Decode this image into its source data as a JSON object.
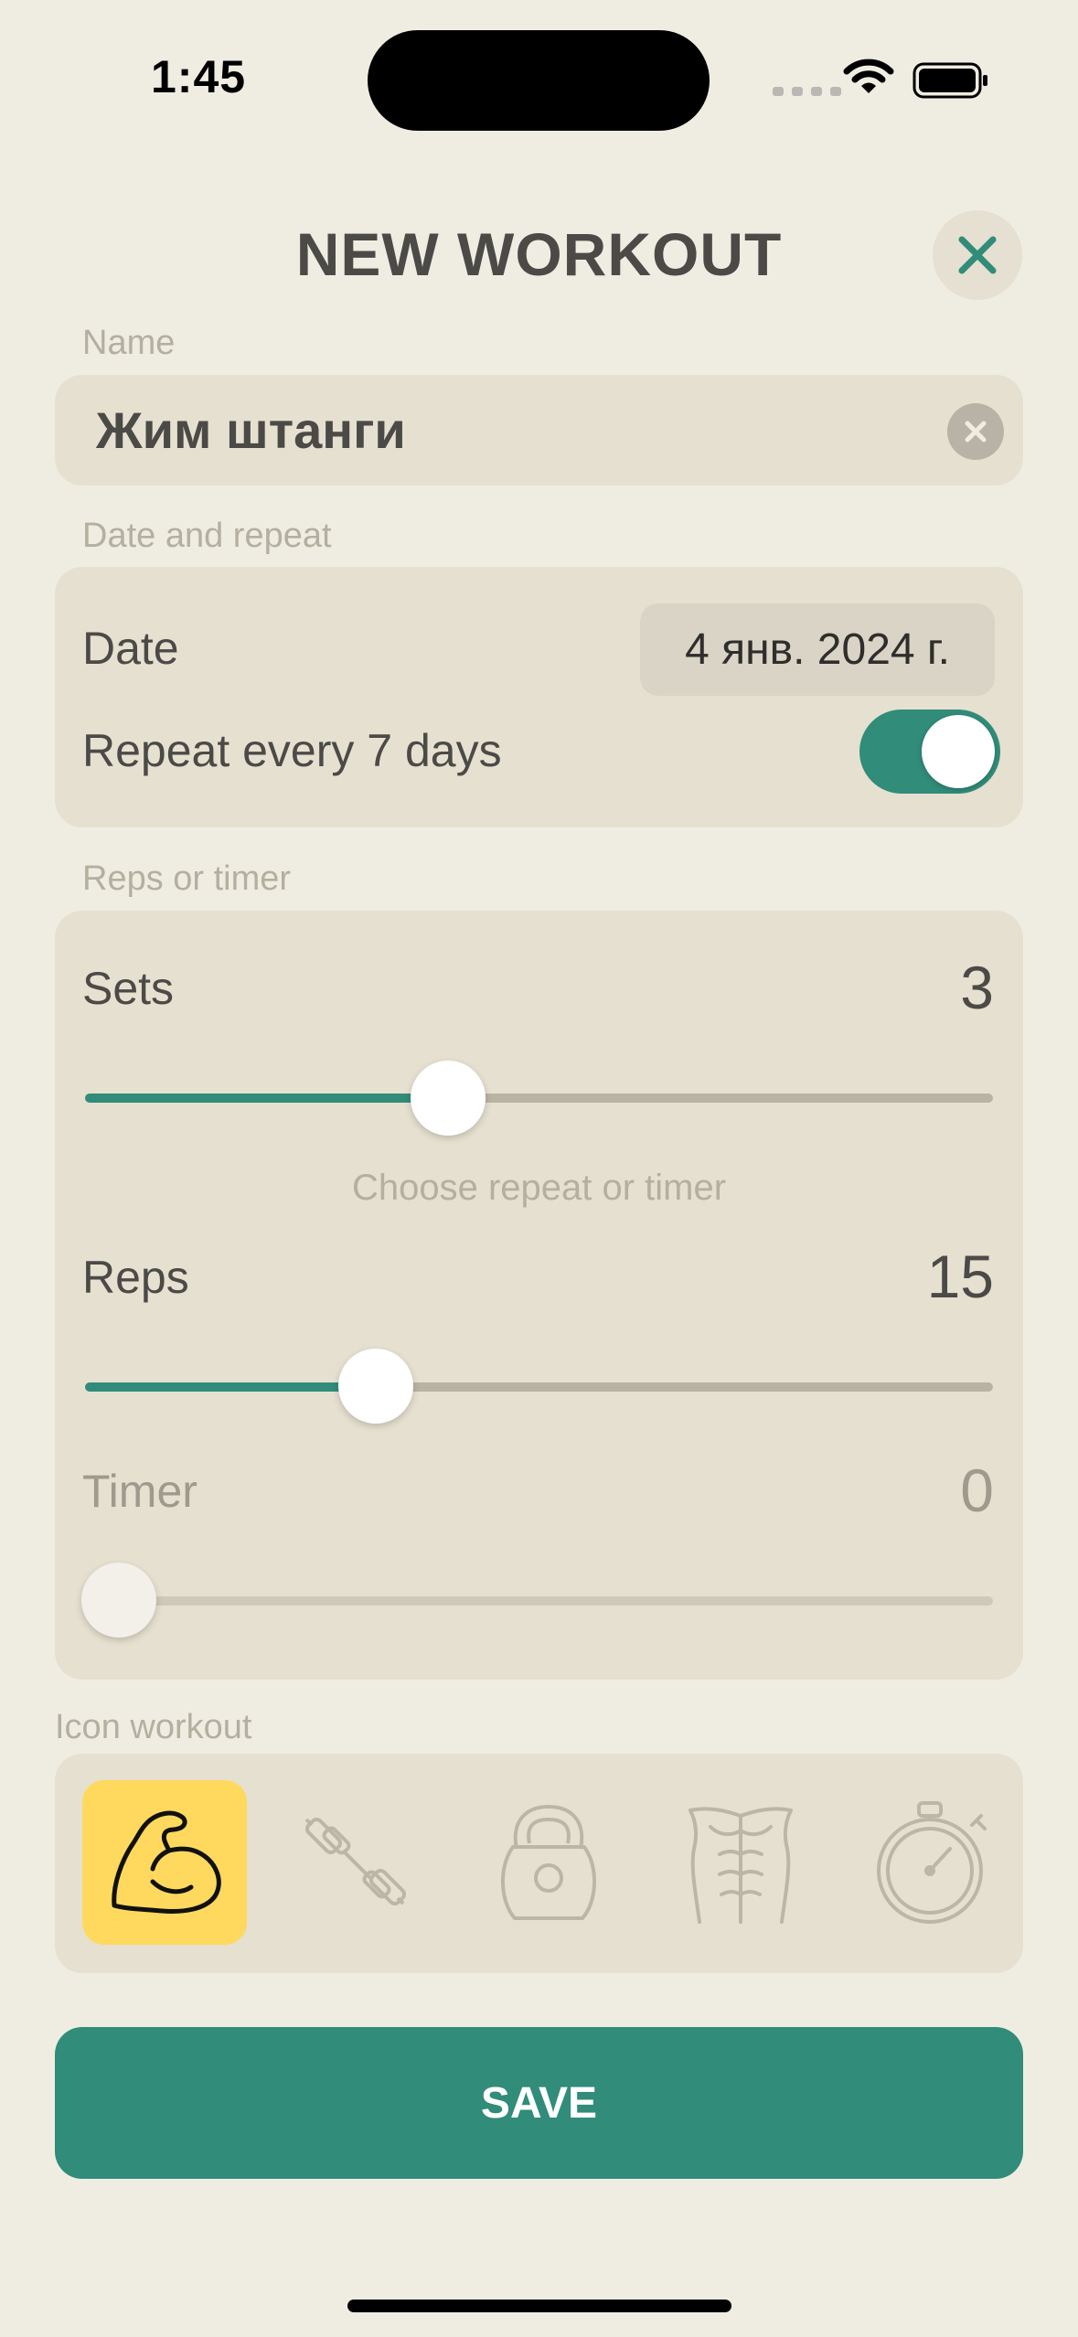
{
  "status_bar": {
    "time": "1:45"
  },
  "header": {
    "title": "NEW WORKOUT"
  },
  "name_section": {
    "label": "Name",
    "value": "Жим штанги"
  },
  "date_section": {
    "label": "Date and repeat",
    "date_label": "Date",
    "date_value": "4 янв. 2024 г.",
    "repeat_label": "Repeat every 7 days",
    "repeat_enabled": true
  },
  "reps_section": {
    "label": "Reps or timer",
    "sets": {
      "label": "Sets",
      "value": "3",
      "fraction": 0.4
    },
    "hint": "Choose repeat or timer",
    "reps": {
      "label": "Reps",
      "value": "15",
      "fraction": 0.32
    },
    "timer": {
      "label": "Timer",
      "value": "0",
      "fraction": 0.0
    }
  },
  "icon_section": {
    "label": "Icon workout",
    "icons": [
      "flexed-biceps-icon",
      "dumbbell-icon",
      "kettlebell-icon",
      "abs-torso-icon",
      "stopwatch-icon"
    ],
    "selected": "flexed-biceps-icon"
  },
  "save_button": {
    "label": "SAVE"
  },
  "colors": {
    "accent": "#318C79",
    "background": "#EFEDE2",
    "card": "#E6E0D0",
    "selected_icon": "#FFD95E"
  }
}
